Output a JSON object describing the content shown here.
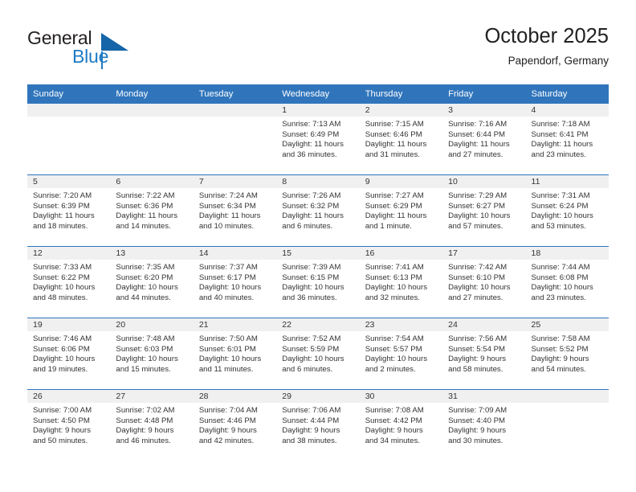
{
  "brand": {
    "word_one": "General",
    "word_two": "Blue",
    "mark_color": "#1565a8",
    "accent_color": "#1f7ac4"
  },
  "header": {
    "title": "October 2025",
    "subtitle": "Papendorf, Germany"
  },
  "theme": {
    "header_blue": "#3075bc",
    "daynum_band": "#f0f0f0",
    "text": "#333333"
  },
  "weekday_headers": [
    "Sunday",
    "Monday",
    "Tuesday",
    "Wednesday",
    "Thursday",
    "Friday",
    "Saturday"
  ],
  "weeks": [
    [
      {
        "day": "",
        "empty": true,
        "sunrise": "",
        "sunset": "",
        "daylight_line1": "",
        "daylight_line2": ""
      },
      {
        "day": "",
        "empty": true,
        "sunrise": "",
        "sunset": "",
        "daylight_line1": "",
        "daylight_line2": ""
      },
      {
        "day": "",
        "empty": true,
        "sunrise": "",
        "sunset": "",
        "daylight_line1": "",
        "daylight_line2": ""
      },
      {
        "day": "1",
        "empty": false,
        "sunrise": "Sunrise: 7:13 AM",
        "sunset": "Sunset: 6:49 PM",
        "daylight_line1": "Daylight: 11 hours",
        "daylight_line2": "and 36 minutes."
      },
      {
        "day": "2",
        "empty": false,
        "sunrise": "Sunrise: 7:15 AM",
        "sunset": "Sunset: 6:46 PM",
        "daylight_line1": "Daylight: 11 hours",
        "daylight_line2": "and 31 minutes."
      },
      {
        "day": "3",
        "empty": false,
        "sunrise": "Sunrise: 7:16 AM",
        "sunset": "Sunset: 6:44 PM",
        "daylight_line1": "Daylight: 11 hours",
        "daylight_line2": "and 27 minutes."
      },
      {
        "day": "4",
        "empty": false,
        "sunrise": "Sunrise: 7:18 AM",
        "sunset": "Sunset: 6:41 PM",
        "daylight_line1": "Daylight: 11 hours",
        "daylight_line2": "and 23 minutes."
      }
    ],
    [
      {
        "day": "5",
        "empty": false,
        "sunrise": "Sunrise: 7:20 AM",
        "sunset": "Sunset: 6:39 PM",
        "daylight_line1": "Daylight: 11 hours",
        "daylight_line2": "and 18 minutes."
      },
      {
        "day": "6",
        "empty": false,
        "sunrise": "Sunrise: 7:22 AM",
        "sunset": "Sunset: 6:36 PM",
        "daylight_line1": "Daylight: 11 hours",
        "daylight_line2": "and 14 minutes."
      },
      {
        "day": "7",
        "empty": false,
        "sunrise": "Sunrise: 7:24 AM",
        "sunset": "Sunset: 6:34 PM",
        "daylight_line1": "Daylight: 11 hours",
        "daylight_line2": "and 10 minutes."
      },
      {
        "day": "8",
        "empty": false,
        "sunrise": "Sunrise: 7:26 AM",
        "sunset": "Sunset: 6:32 PM",
        "daylight_line1": "Daylight: 11 hours",
        "daylight_line2": "and 6 minutes."
      },
      {
        "day": "9",
        "empty": false,
        "sunrise": "Sunrise: 7:27 AM",
        "sunset": "Sunset: 6:29 PM",
        "daylight_line1": "Daylight: 11 hours",
        "daylight_line2": "and 1 minute."
      },
      {
        "day": "10",
        "empty": false,
        "sunrise": "Sunrise: 7:29 AM",
        "sunset": "Sunset: 6:27 PM",
        "daylight_line1": "Daylight: 10 hours",
        "daylight_line2": "and 57 minutes."
      },
      {
        "day": "11",
        "empty": false,
        "sunrise": "Sunrise: 7:31 AM",
        "sunset": "Sunset: 6:24 PM",
        "daylight_line1": "Daylight: 10 hours",
        "daylight_line2": "and 53 minutes."
      }
    ],
    [
      {
        "day": "12",
        "empty": false,
        "sunrise": "Sunrise: 7:33 AM",
        "sunset": "Sunset: 6:22 PM",
        "daylight_line1": "Daylight: 10 hours",
        "daylight_line2": "and 48 minutes."
      },
      {
        "day": "13",
        "empty": false,
        "sunrise": "Sunrise: 7:35 AM",
        "sunset": "Sunset: 6:20 PM",
        "daylight_line1": "Daylight: 10 hours",
        "daylight_line2": "and 44 minutes."
      },
      {
        "day": "14",
        "empty": false,
        "sunrise": "Sunrise: 7:37 AM",
        "sunset": "Sunset: 6:17 PM",
        "daylight_line1": "Daylight: 10 hours",
        "daylight_line2": "and 40 minutes."
      },
      {
        "day": "15",
        "empty": false,
        "sunrise": "Sunrise: 7:39 AM",
        "sunset": "Sunset: 6:15 PM",
        "daylight_line1": "Daylight: 10 hours",
        "daylight_line2": "and 36 minutes."
      },
      {
        "day": "16",
        "empty": false,
        "sunrise": "Sunrise: 7:41 AM",
        "sunset": "Sunset: 6:13 PM",
        "daylight_line1": "Daylight: 10 hours",
        "daylight_line2": "and 32 minutes."
      },
      {
        "day": "17",
        "empty": false,
        "sunrise": "Sunrise: 7:42 AM",
        "sunset": "Sunset: 6:10 PM",
        "daylight_line1": "Daylight: 10 hours",
        "daylight_line2": "and 27 minutes."
      },
      {
        "day": "18",
        "empty": false,
        "sunrise": "Sunrise: 7:44 AM",
        "sunset": "Sunset: 6:08 PM",
        "daylight_line1": "Daylight: 10 hours",
        "daylight_line2": "and 23 minutes."
      }
    ],
    [
      {
        "day": "19",
        "empty": false,
        "sunrise": "Sunrise: 7:46 AM",
        "sunset": "Sunset: 6:06 PM",
        "daylight_line1": "Daylight: 10 hours",
        "daylight_line2": "and 19 minutes."
      },
      {
        "day": "20",
        "empty": false,
        "sunrise": "Sunrise: 7:48 AM",
        "sunset": "Sunset: 6:03 PM",
        "daylight_line1": "Daylight: 10 hours",
        "daylight_line2": "and 15 minutes."
      },
      {
        "day": "21",
        "empty": false,
        "sunrise": "Sunrise: 7:50 AM",
        "sunset": "Sunset: 6:01 PM",
        "daylight_line1": "Daylight: 10 hours",
        "daylight_line2": "and 11 minutes."
      },
      {
        "day": "22",
        "empty": false,
        "sunrise": "Sunrise: 7:52 AM",
        "sunset": "Sunset: 5:59 PM",
        "daylight_line1": "Daylight: 10 hours",
        "daylight_line2": "and 6 minutes."
      },
      {
        "day": "23",
        "empty": false,
        "sunrise": "Sunrise: 7:54 AM",
        "sunset": "Sunset: 5:57 PM",
        "daylight_line1": "Daylight: 10 hours",
        "daylight_line2": "and 2 minutes."
      },
      {
        "day": "24",
        "empty": false,
        "sunrise": "Sunrise: 7:56 AM",
        "sunset": "Sunset: 5:54 PM",
        "daylight_line1": "Daylight: 9 hours",
        "daylight_line2": "and 58 minutes."
      },
      {
        "day": "25",
        "empty": false,
        "sunrise": "Sunrise: 7:58 AM",
        "sunset": "Sunset: 5:52 PM",
        "daylight_line1": "Daylight: 9 hours",
        "daylight_line2": "and 54 minutes."
      }
    ],
    [
      {
        "day": "26",
        "empty": false,
        "sunrise": "Sunrise: 7:00 AM",
        "sunset": "Sunset: 4:50 PM",
        "daylight_line1": "Daylight: 9 hours",
        "daylight_line2": "and 50 minutes."
      },
      {
        "day": "27",
        "empty": false,
        "sunrise": "Sunrise: 7:02 AM",
        "sunset": "Sunset: 4:48 PM",
        "daylight_line1": "Daylight: 9 hours",
        "daylight_line2": "and 46 minutes."
      },
      {
        "day": "28",
        "empty": false,
        "sunrise": "Sunrise: 7:04 AM",
        "sunset": "Sunset: 4:46 PM",
        "daylight_line1": "Daylight: 9 hours",
        "daylight_line2": "and 42 minutes."
      },
      {
        "day": "29",
        "empty": false,
        "sunrise": "Sunrise: 7:06 AM",
        "sunset": "Sunset: 4:44 PM",
        "daylight_line1": "Daylight: 9 hours",
        "daylight_line2": "and 38 minutes."
      },
      {
        "day": "30",
        "empty": false,
        "sunrise": "Sunrise: 7:08 AM",
        "sunset": "Sunset: 4:42 PM",
        "daylight_line1": "Daylight: 9 hours",
        "daylight_line2": "and 34 minutes."
      },
      {
        "day": "31",
        "empty": false,
        "sunrise": "Sunrise: 7:09 AM",
        "sunset": "Sunset: 4:40 PM",
        "daylight_line1": "Daylight: 9 hours",
        "daylight_line2": "and 30 minutes."
      },
      {
        "day": "",
        "empty": true,
        "sunrise": "",
        "sunset": "",
        "daylight_line1": "",
        "daylight_line2": ""
      }
    ]
  ]
}
